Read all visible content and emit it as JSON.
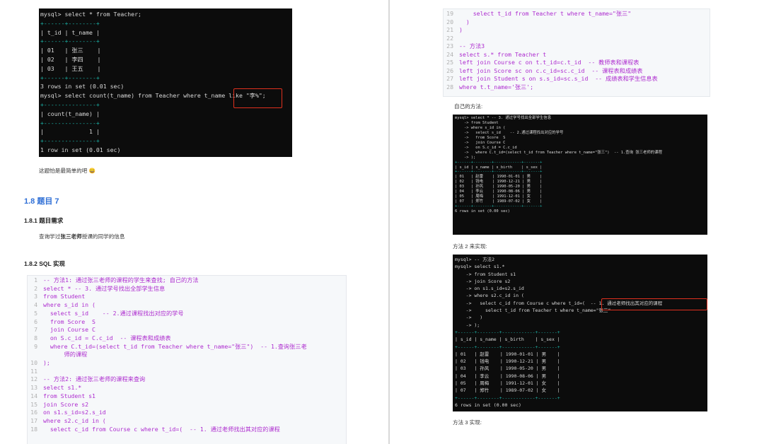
{
  "left": {
    "terminal": {
      "lines": [
        {
          "t": "mysql> select * from Teacher;",
          "c": ""
        },
        {
          "t": "+------+--------+",
          "c": "dash"
        },
        {
          "t": "| t_id | t_name |",
          "c": ""
        },
        {
          "t": "+------+--------+",
          "c": "dash"
        },
        {
          "t": "| 01   | 张三    |",
          "c": ""
        },
        {
          "t": "| 02   | 李四    |",
          "c": ""
        },
        {
          "t": "| 03   | 王五    |",
          "c": ""
        },
        {
          "t": "+------+--------+",
          "c": "dash"
        },
        {
          "t": "3 rows in set (0.01 sec)",
          "c": ""
        },
        {
          "t": "",
          "c": ""
        },
        {
          "t": "mysql> select count(t_name) from Teacher where t_name like \"李%\";",
          "c": ""
        },
        {
          "t": "+---------------+",
          "c": "dash"
        },
        {
          "t": "| count(t_name) |",
          "c": ""
        },
        {
          "t": "+---------------+",
          "c": "dash"
        },
        {
          "t": "|             1 |",
          "c": ""
        },
        {
          "t": "+---------------+",
          "c": "dash"
        },
        {
          "t": "1 row in set (0.01 sec)",
          "c": ""
        }
      ]
    },
    "note": "这题怕是最简单的吧 😀",
    "section_heading": "1.8  题目 7",
    "sub1_heading": "1.8.1  题目需求",
    "requirement_prefix": "查询学过",
    "requirement_bold": "张三老师",
    "requirement_suffix": "授课的同学的信息",
    "sub2_heading": "1.8.2  SQL 实现",
    "code": [
      {
        "n": "1",
        "t": "-- 方法1: 通过张三老师的课程的学生来查找; 自己的方法"
      },
      {
        "n": "2",
        "t": "select * -- 3. 通过学号找出全部学生信息"
      },
      {
        "n": "3",
        "t": "from Student"
      },
      {
        "n": "4",
        "t": "where s_id in ("
      },
      {
        "n": "5",
        "t": "  select s_id    -- 2.通过课程找出对应的学号"
      },
      {
        "n": "6",
        "t": "  from Score  S"
      },
      {
        "n": "7",
        "t": "  join Course C"
      },
      {
        "n": "8",
        "t": "  on S.c_id = C.c_id  -- 课程表和成绩表"
      },
      {
        "n": "9",
        "t": "  where C.t_id=(select t_id from Teacher where t_name=\"张三\")  -- 1.查询张三老"
      },
      {
        "n": "",
        "t": "      师的课程"
      },
      {
        "n": "10",
        "t": ");"
      },
      {
        "n": "11",
        "t": ""
      },
      {
        "n": "12",
        "t": "-- 方法2: 通过张三老师的课程来查询"
      },
      {
        "n": "13",
        "t": "select s1.*"
      },
      {
        "n": "14",
        "t": "from Student s1"
      },
      {
        "n": "15",
        "t": "join Score s2"
      },
      {
        "n": "16",
        "t": "on s1.s_id=s2.s_id"
      },
      {
        "n": "17",
        "t": "where s2.c_id in ("
      },
      {
        "n": "18",
        "t": "  select c_id from Course c where t_id=(  -- 1. 通过老师找出其对应的课程"
      }
    ]
  },
  "right": {
    "code": [
      {
        "n": "19",
        "t": "    select t_id from Teacher t where t_name=\"张三\""
      },
      {
        "n": "20",
        "t": "  )"
      },
      {
        "n": "21",
        "t": ")"
      },
      {
        "n": "22",
        "t": ""
      },
      {
        "n": "23",
        "t": "-- 方法3"
      },
      {
        "n": "24",
        "t": "select s.* from Teacher t"
      },
      {
        "n": "25",
        "t": "left join Course c on t.t_id=c.t_id  -- 教师表和课程表"
      },
      {
        "n": "26",
        "t": "left join Score sc on c.c_id=sc.c_id  -- 课程表和成绩表"
      },
      {
        "n": "27",
        "t": "left join Student s on s.s_id=sc.s_id  -- 成绩表和学生信息表"
      },
      {
        "n": "28",
        "t": "where t.t_name='张三';"
      }
    ],
    "own_method_label": "自己的方法:",
    "terminal2": {
      "lines": [
        {
          "t": "mysql> select * -- 3. 通过学号找出全部学生信息",
          "c": ""
        },
        {
          "t": "    -> from Student",
          "c": ""
        },
        {
          "t": "    -> where s_id in (",
          "c": ""
        },
        {
          "t": "    ->   select s_id    -- 2.通过课程找出对应的学号",
          "c": ""
        },
        {
          "t": "    ->   from Score  S",
          "c": ""
        },
        {
          "t": "    ->   join Course C",
          "c": ""
        },
        {
          "t": "    ->   on S.c_id = C.c_id",
          "c": ""
        },
        {
          "t": "    ->   where C.t_id=(select t_id from Teacher where t_name=\"张三\")  -- 1.查询 张三老师的课程",
          "c": ""
        },
        {
          "t": "    -> );",
          "c": ""
        },
        {
          "t": "+------+--------+------------+-------+",
          "c": "dash"
        },
        {
          "t": "| s_id | s_name | s_birth    | s_sex |",
          "c": ""
        },
        {
          "t": "+------+--------+------------+-------+",
          "c": "dash"
        },
        {
          "t": "| 01   | 赵雷    | 1990-01-01 | 男    |",
          "c": ""
        },
        {
          "t": "| 02   | 钱电    | 1990-12-21 | 男    |",
          "c": ""
        },
        {
          "t": "| 03   | 孙风    | 1990-05-20 | 男    |",
          "c": ""
        },
        {
          "t": "| 04   | 李云    | 1990-08-06 | 男    |",
          "c": ""
        },
        {
          "t": "| 05   | 周梅    | 1991-12-01 | 女    |",
          "c": ""
        },
        {
          "t": "| 07   | 郑竹    | 1989-07-02 | 女    |",
          "c": ""
        },
        {
          "t": "+------+--------+------------+-------+",
          "c": "dash"
        },
        {
          "t": "6 rows in set (0.00 sec)",
          "c": ""
        }
      ]
    },
    "method2_label": "方法 2 来实现:",
    "terminal3": {
      "lines": [
        {
          "t": "mysql> -- 方法2",
          "c": ""
        },
        {
          "t": "mysql> select s1.*",
          "c": ""
        },
        {
          "t": "    -> from Student s1",
          "c": ""
        },
        {
          "t": "    -> join Score s2",
          "c": ""
        },
        {
          "t": "    -> on s1.s_id=s2.s_id",
          "c": ""
        },
        {
          "t": "    -> where s2.c_id in (",
          "c": ""
        },
        {
          "t": "    ->   select c_id from Course c where t_id=(  -- 1. 通过老师找出其对应的课程",
          "c": ""
        },
        {
          "t": "    ->     select t_id from Teacher t where t_name=\"张三\"",
          "c": ""
        },
        {
          "t": "    ->   )",
          "c": ""
        },
        {
          "t": "    -> );",
          "c": ""
        },
        {
          "t": "+------+--------+------------+-------+",
          "c": "dash"
        },
        {
          "t": "| s_id | s_name | s_birth    | s_sex |",
          "c": ""
        },
        {
          "t": "+------+--------+------------+-------+",
          "c": "dash"
        },
        {
          "t": "| 01   | 赵雷    | 1990-01-01 | 男    |",
          "c": ""
        },
        {
          "t": "| 02   | 钱电    | 1990-12-21 | 男    |",
          "c": ""
        },
        {
          "t": "| 03   | 孙风    | 1990-05-20 | 男    |",
          "c": ""
        },
        {
          "t": "| 04   | 李云    | 1990-08-06 | 男    |",
          "c": ""
        },
        {
          "t": "| 05   | 周梅    | 1991-12-01 | 女    |",
          "c": ""
        },
        {
          "t": "| 07   | 郑竹    | 1989-07-02 | 女    |",
          "c": ""
        },
        {
          "t": "+------+--------+------------+-------+",
          "c": "dash"
        },
        {
          "t": "6 rows in set (0.00 sec)",
          "c": ""
        }
      ]
    },
    "method3_label": "方法 3 实现:"
  }
}
